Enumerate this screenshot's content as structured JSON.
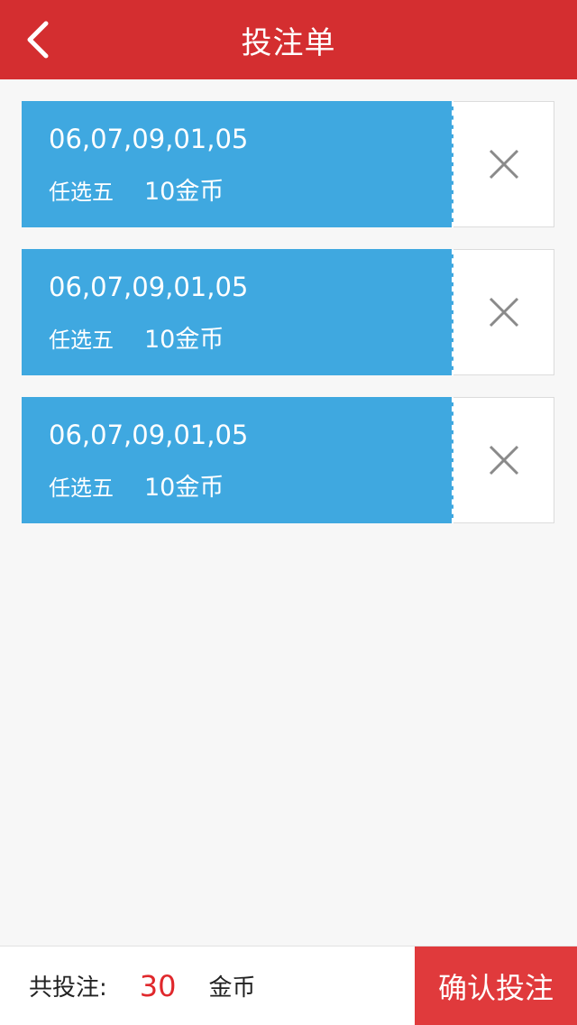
{
  "header": {
    "title": "投注单",
    "back_icon": "chevron-left-icon"
  },
  "tickets": [
    {
      "numbers": "06,07,09,01,05",
      "type": "任选五",
      "amount": "10金币"
    },
    {
      "numbers": "06,07,09,01,05",
      "type": "任选五",
      "amount": "10金币"
    },
    {
      "numbers": "06,07,09,01,05",
      "type": "任选五",
      "amount": "10金币"
    }
  ],
  "footer": {
    "total_label": "共投注:",
    "total_value": "30",
    "total_unit": "金币",
    "confirm_label": "确认投注"
  },
  "colors": {
    "header_bg": "#d42e30",
    "ticket_bg": "#3fa8e0",
    "confirm_bg": "#e03a3c",
    "total_text": "#e0282c"
  }
}
